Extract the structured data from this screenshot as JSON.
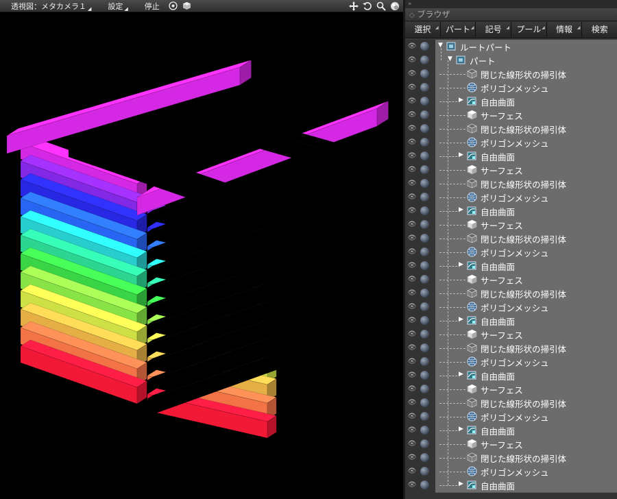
{
  "viewport": {
    "menus": [
      {
        "label": "透視図：メタカメラ１"
      },
      {
        "label": "設定"
      },
      {
        "label": "停止"
      }
    ],
    "toolbar_icons": [
      "target-icon",
      "shading-cube-icon",
      "move-icon",
      "rotate-icon",
      "zoom-icon",
      "render-ball-icon"
    ]
  },
  "browser": {
    "top_marker": "»",
    "title": "ブラウザ",
    "tabs": [
      "選択",
      "パート",
      "記号",
      "プール",
      "情報",
      "検索"
    ],
    "tree": [
      {
        "label": "ルートパート",
        "icon": "part-icon",
        "level": 0,
        "expander": "open"
      },
      {
        "label": "パート",
        "icon": "part-icon",
        "level": 1,
        "expander": "open"
      },
      {
        "label": "閉じた線形状の掃引体",
        "icon": "sweep-icon",
        "level": 2
      },
      {
        "label": "ポリゴンメッシュ",
        "icon": "mesh-icon",
        "level": 2
      },
      {
        "label": "自由曲面",
        "icon": "freeform-icon",
        "level": 2,
        "expander": "closed"
      },
      {
        "label": "サーフェス",
        "icon": "surface-icon",
        "level": 2
      },
      {
        "label": "閉じた線形状の掃引体",
        "icon": "sweep-icon",
        "level": 2
      },
      {
        "label": "ポリゴンメッシュ",
        "icon": "mesh-icon",
        "level": 2
      },
      {
        "label": "自由曲面",
        "icon": "freeform-icon",
        "level": 2,
        "expander": "closed"
      },
      {
        "label": "サーフェス",
        "icon": "surface-icon",
        "level": 2
      },
      {
        "label": "閉じた線形状の掃引体",
        "icon": "sweep-icon",
        "level": 2
      },
      {
        "label": "ポリゴンメッシュ",
        "icon": "mesh-icon",
        "level": 2
      },
      {
        "label": "自由曲面",
        "icon": "freeform-icon",
        "level": 2,
        "expander": "closed"
      },
      {
        "label": "サーフェス",
        "icon": "surface-icon",
        "level": 2
      },
      {
        "label": "閉じた線形状の掃引体",
        "icon": "sweep-icon",
        "level": 2
      },
      {
        "label": "ポリゴンメッシュ",
        "icon": "mesh-icon",
        "level": 2
      },
      {
        "label": "自由曲面",
        "icon": "freeform-icon",
        "level": 2,
        "expander": "closed"
      },
      {
        "label": "サーフェス",
        "icon": "surface-icon",
        "level": 2
      },
      {
        "label": "閉じた線形状の掃引体",
        "icon": "sweep-icon",
        "level": 2
      },
      {
        "label": "ポリゴンメッシュ",
        "icon": "mesh-icon",
        "level": 2
      },
      {
        "label": "自由曲面",
        "icon": "freeform-icon",
        "level": 2,
        "expander": "closed"
      },
      {
        "label": "サーフェス",
        "icon": "surface-icon",
        "level": 2
      },
      {
        "label": "閉じた線形状の掃引体",
        "icon": "sweep-icon",
        "level": 2
      },
      {
        "label": "ポリゴンメッシュ",
        "icon": "mesh-icon",
        "level": 2
      },
      {
        "label": "自由曲面",
        "icon": "freeform-icon",
        "level": 2,
        "expander": "closed"
      },
      {
        "label": "サーフェス",
        "icon": "surface-icon",
        "level": 2
      },
      {
        "label": "閉じた線形状の掃引体",
        "icon": "sweep-icon",
        "level": 2
      },
      {
        "label": "ポリゴンメッシュ",
        "icon": "mesh-icon",
        "level": 2
      },
      {
        "label": "自由曲面",
        "icon": "freeform-icon",
        "level": 2,
        "expander": "closed"
      },
      {
        "label": "サーフェス",
        "icon": "surface-icon",
        "level": 2
      },
      {
        "label": "閉じた線形状の掃引体",
        "icon": "sweep-icon",
        "level": 2
      },
      {
        "label": "ポリゴンメッシュ",
        "icon": "mesh-icon",
        "level": 2
      },
      {
        "label": "自由曲面",
        "icon": "freeform-icon",
        "level": 2,
        "expander": "closed"
      }
    ]
  },
  "scene": {
    "layer_colors": [
      "#ff1a3a",
      "#ff7a4a",
      "#f2b84a",
      "#d8ec4a",
      "#8ff04a",
      "#3ce04a",
      "#2ee09a",
      "#2ad8d8",
      "#2a6aff",
      "#2a2af0",
      "#8a2af0",
      "#e02af0"
    ]
  }
}
